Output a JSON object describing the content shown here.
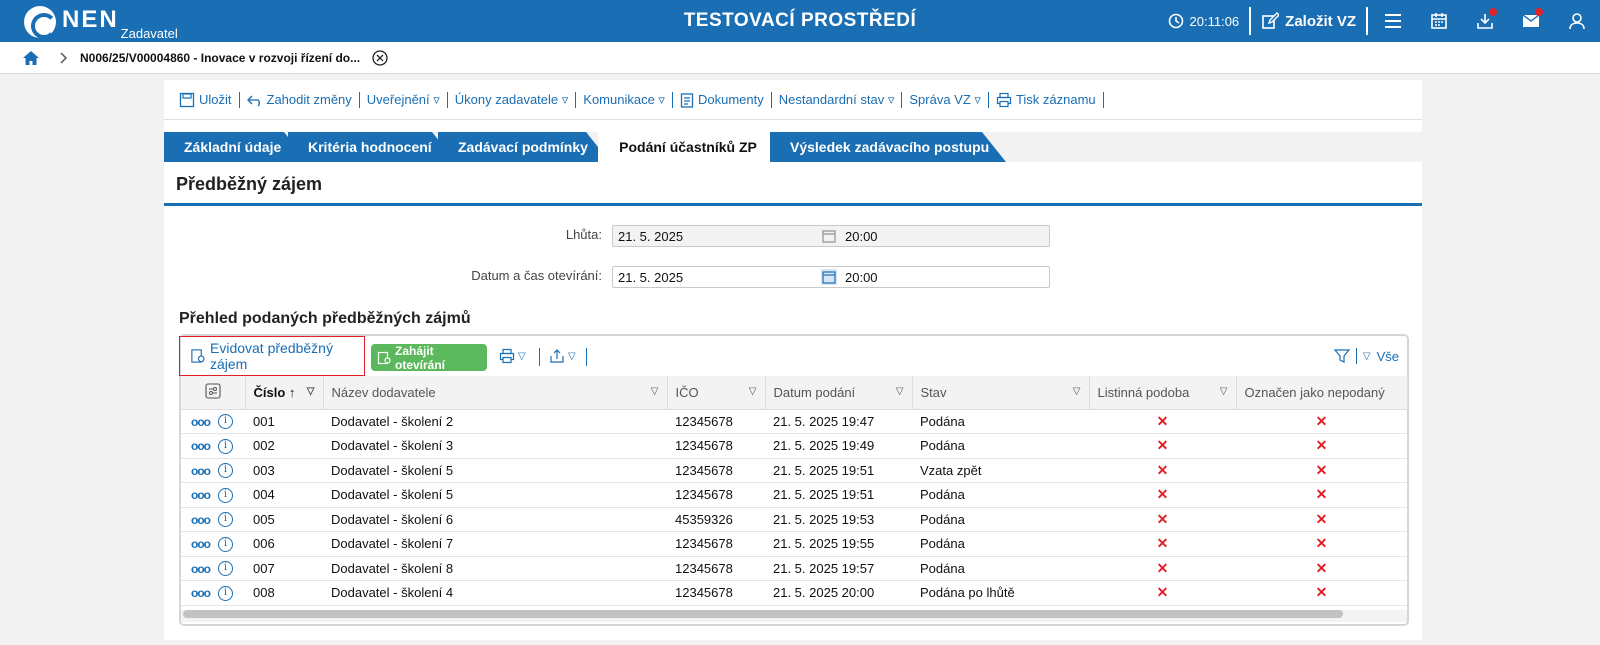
{
  "header": {
    "logo": "NEN",
    "logo_sub": "Zadavatel",
    "env_title": "TESTOVACÍ PROSTŘEDÍ",
    "clock": "20:11:06",
    "create_label": "Založit VZ"
  },
  "breadcrumb": {
    "title": "N006/25/V00004860 - Inovace v rozvoji řízení do..."
  },
  "toolbar": {
    "items": [
      "Uložit",
      "Zahodit změny",
      "Uveřejnění ▿",
      "Úkony zadavatele ▿",
      "Komunikace ▿",
      "Dokumenty",
      "Nestandardní stav ▿",
      "Správa VZ ▿",
      "Tisk záznamu"
    ]
  },
  "tabs": [
    "Základní údaje",
    "Kritéria hodnocení",
    "Zadávací podmínky",
    "Podání účastníků ZP",
    "Výsledek zadávacího postupu"
  ],
  "section": {
    "title": "Předběžný zájem"
  },
  "form": {
    "deadline_label": "Lhůta:",
    "deadline_date": "21. 5. 2025",
    "deadline_time": "20:00",
    "opening_label": "Datum a čas otevírání:",
    "opening_date": "21. 5. 2025",
    "opening_time": "20:00"
  },
  "overview": {
    "title": "Přehled podaných předběžných zájmů",
    "evid_label": "Evidovat předběžný zájem",
    "start_label": "Zahájit otevírání",
    "all_label": "Vše"
  },
  "table": {
    "columns": [
      "Číslo",
      "Název dodavatele",
      "IČO",
      "Datum podání",
      "Stav",
      "Listinná podoba",
      "Označen jako nepodaný"
    ],
    "rows": [
      {
        "num": "001",
        "name": "Dodavatel - školení 2",
        "ico": "12345678",
        "date": "21. 5. 2025 19:47",
        "state": "Podána",
        "paper": "✕",
        "unsub": "✕"
      },
      {
        "num": "002",
        "name": "Dodavatel - školení 3",
        "ico": "12345678",
        "date": "21. 5. 2025 19:49",
        "state": "Podána",
        "paper": "✕",
        "unsub": "✕"
      },
      {
        "num": "003",
        "name": "Dodavatel - školení 5",
        "ico": "12345678",
        "date": "21. 5. 2025 19:51",
        "state": "Vzata zpět",
        "paper": "✕",
        "unsub": "✕"
      },
      {
        "num": "004",
        "name": "Dodavatel - školení 5",
        "ico": "12345678",
        "date": "21. 5. 2025 19:51",
        "state": "Podána",
        "paper": "✕",
        "unsub": "✕"
      },
      {
        "num": "005",
        "name": "Dodavatel - školení 6",
        "ico": "45359326",
        "date": "21. 5. 2025 19:53",
        "state": "Podána",
        "paper": "✕",
        "unsub": "✕"
      },
      {
        "num": "006",
        "name": "Dodavatel - školení 7",
        "ico": "12345678",
        "date": "21. 5. 2025 19:55",
        "state": "Podána",
        "paper": "✕",
        "unsub": "✕"
      },
      {
        "num": "007",
        "name": "Dodavatel - školení 8",
        "ico": "12345678",
        "date": "21. 5. 2025 19:57",
        "state": "Podána",
        "paper": "✕",
        "unsub": "✕"
      },
      {
        "num": "008",
        "name": "Dodavatel - školení 4",
        "ico": "12345678",
        "date": "21. 5. 2025 20:00",
        "state": "Podána po lhůtě",
        "paper": "✕",
        "unsub": "✕"
      }
    ]
  }
}
